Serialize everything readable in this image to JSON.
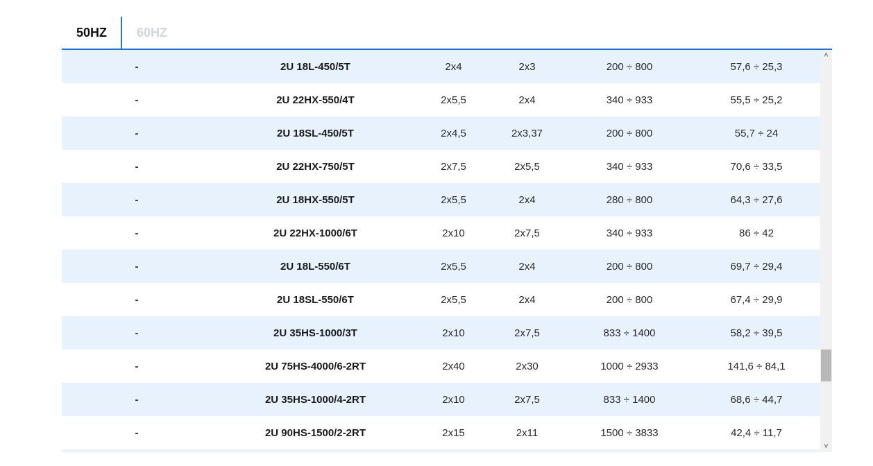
{
  "tabs": [
    {
      "label": "50HZ",
      "active": true
    },
    {
      "label": "60HZ",
      "active": false
    }
  ],
  "table": {
    "rows": [
      {
        "c0": "-",
        "model": "2U 18L-450/5T",
        "c2": "2x4",
        "c3": "2x3",
        "range": "200 ÷ 800",
        "values": "57,6 ÷ 25,3"
      },
      {
        "c0": "-",
        "model": "2U 22HX-550/4T",
        "c2": "2x5,5",
        "c3": "2x4",
        "range": "340 ÷ 933",
        "values": "55,5 ÷ 25,2"
      },
      {
        "c0": "-",
        "model": "2U 18SL-450/5T",
        "c2": "2x4,5",
        "c3": "2x3,37",
        "range": "200 ÷ 800",
        "values": "55,7 ÷ 24"
      },
      {
        "c0": "-",
        "model": "2U 22HX-750/5T",
        "c2": "2x7,5",
        "c3": "2x5,5",
        "range": "340 ÷ 933",
        "values": "70,6 ÷ 33,5"
      },
      {
        "c0": "-",
        "model": "2U 18HX-550/5T",
        "c2": "2x5,5",
        "c3": "2x4",
        "range": "280 ÷ 800",
        "values": "64,3 ÷ 27,6"
      },
      {
        "c0": "-",
        "model": "2U 22HX-1000/6T",
        "c2": "2x10",
        "c3": "2x7,5",
        "range": "340 ÷ 933",
        "values": "86 ÷ 42"
      },
      {
        "c0": "-",
        "model": "2U 18L-550/6T",
        "c2": "2x5,5",
        "c3": "2x4",
        "range": "200 ÷ 800",
        "values": "69,7 ÷ 29,4"
      },
      {
        "c0": "-",
        "model": "2U 18SL-550/6T",
        "c2": "2x5,5",
        "c3": "2x4",
        "range": "200 ÷ 800",
        "values": "67,4 ÷ 29,9"
      },
      {
        "c0": "-",
        "model": "2U 35HS-1000/3T",
        "c2": "2x10",
        "c3": "2x7,5",
        "range": "833 ÷ 1400",
        "values": "58,2 ÷ 39,5"
      },
      {
        "c0": "-",
        "model": "2U 75HS-4000/6-2RT",
        "c2": "2x40",
        "c3": "2x30",
        "range": "1000 ÷ 2933",
        "values": "141,6 ÷ 84,1"
      },
      {
        "c0": "-",
        "model": "2U 35HS-1000/4-2RT",
        "c2": "2x10",
        "c3": "2x7,5",
        "range": "833 ÷ 1400",
        "values": "68,6 ÷ 44,7"
      },
      {
        "c0": "-",
        "model": "2U 90HS-1500/2-2RT",
        "c2": "2x15",
        "c3": "2x11",
        "range": "1500 ÷ 3833",
        "values": "42,4 ÷ 11,7"
      },
      {
        "c0": "",
        "model": "",
        "c2": "",
        "c3": "",
        "range": "",
        "values": ""
      }
    ]
  },
  "scrollbar": {
    "up_glyph": "˄",
    "down_glyph": "˅"
  }
}
